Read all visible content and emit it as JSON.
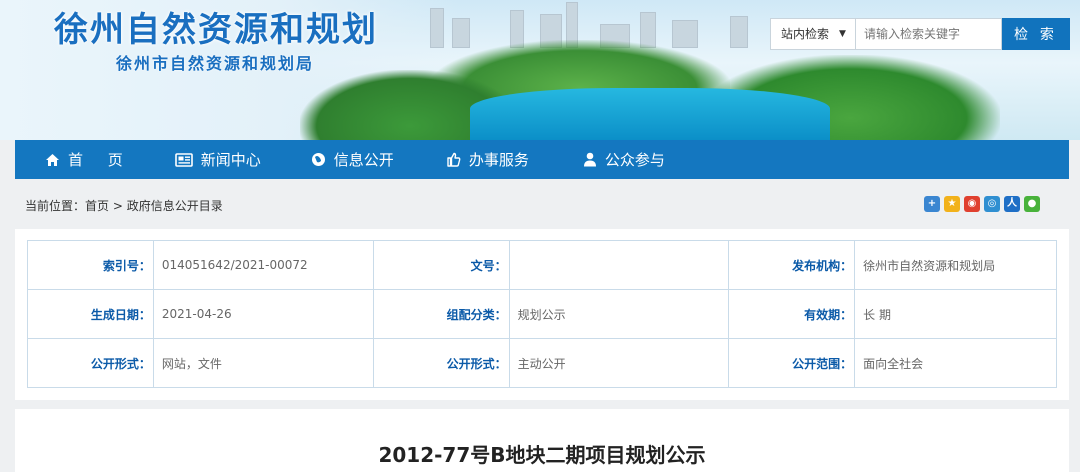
{
  "header": {
    "site_title": "徐州自然资源和规划",
    "site_subtitle": "徐州市自然资源和规划局"
  },
  "search": {
    "scope_label": "站内检索",
    "placeholder": "请输入检索关键字",
    "button_label": "检 索"
  },
  "nav": [
    {
      "label": "首 页",
      "icon": "home-icon"
    },
    {
      "label": "新闻中心",
      "icon": "newspaper-icon"
    },
    {
      "label": "信息公开",
      "icon": "globe-icon"
    },
    {
      "label": "办事服务",
      "icon": "thumbs-up-icon"
    },
    {
      "label": "公众参与",
      "icon": "user-icon"
    }
  ],
  "breadcrumb": {
    "prefix": "当前位置：",
    "items": [
      "首页",
      "政府信息公开目录"
    ],
    "separator": ">"
  },
  "share_icons": [
    "plus-share-icon",
    "qzone-icon",
    "weibo-icon",
    "tencent-weibo-icon",
    "renren-icon",
    "wechat-icon"
  ],
  "colors": {
    "brand_blue": "#1477c0",
    "label_blue": "#0b5aa8"
  },
  "meta": {
    "rows": [
      [
        {
          "label": "索引号：",
          "value": "014051642/2021-00072"
        },
        {
          "label": "文号：",
          "value": ""
        },
        {
          "label": "发布机构：",
          "value": "徐州市自然资源和规划局"
        }
      ],
      [
        {
          "label": "生成日期：",
          "value": "2021-04-26"
        },
        {
          "label": "组配分类：",
          "value": "规划公示"
        },
        {
          "label": "有效期：",
          "value": "长 期"
        }
      ],
      [
        {
          "label": "公开形式：",
          "value": "网站，文件"
        },
        {
          "label": "公开形式：",
          "value": "主动公开"
        },
        {
          "label": "公开范围：",
          "value": "面向全社会"
        }
      ]
    ]
  },
  "article": {
    "title": "2012-77号B地块二期项目规划公示"
  }
}
